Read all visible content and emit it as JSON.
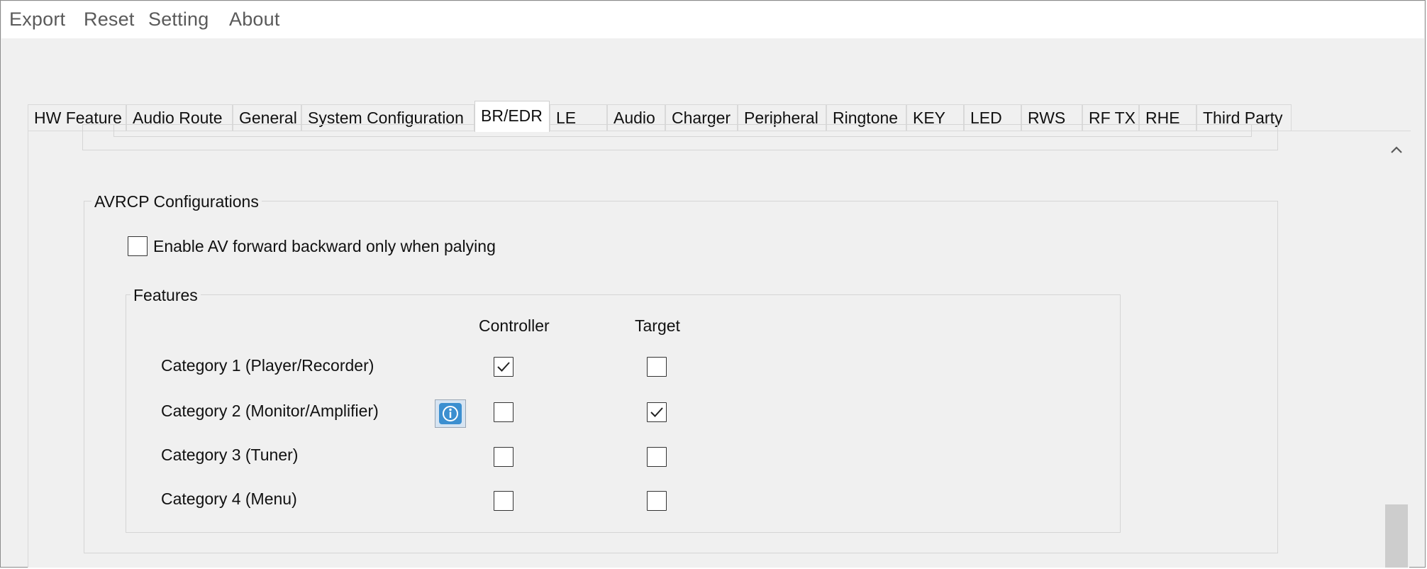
{
  "menu": {
    "items": [
      "Export",
      "Reset",
      "Setting",
      "About"
    ]
  },
  "tabs": [
    {
      "label": "HW Feature",
      "active": false
    },
    {
      "label": "Audio Route",
      "active": false
    },
    {
      "label": "General",
      "active": false
    },
    {
      "label": "System Configuration",
      "active": false
    },
    {
      "label": "BR/EDR",
      "active": true
    },
    {
      "label": "LE",
      "active": false
    },
    {
      "label": "Audio",
      "active": false
    },
    {
      "label": "Charger",
      "active": false
    },
    {
      "label": "Peripheral",
      "active": false
    },
    {
      "label": "Ringtone",
      "active": false
    },
    {
      "label": "KEY",
      "active": false
    },
    {
      "label": "LED",
      "active": false
    },
    {
      "label": "RWS",
      "active": false
    },
    {
      "label": "RF TX",
      "active": false
    },
    {
      "label": "RHE",
      "active": false
    },
    {
      "label": "Third Party",
      "active": false
    }
  ],
  "avrcp": {
    "title": "AVRCP Configurations",
    "enable_av_label": "Enable AV forward backward only when palying",
    "enable_av_checked": false,
    "features": {
      "title": "Features",
      "col_controller": "Controller",
      "col_target": "Target",
      "rows": [
        {
          "label": "Category 1 (Player/Recorder)",
          "controller": true,
          "target": false,
          "info": false
        },
        {
          "label": "Category 2 (Monitor/Amplifier)",
          "controller": false,
          "target": true,
          "info": true
        },
        {
          "label": "Category 3 (Tuner)",
          "controller": false,
          "target": false,
          "info": false
        },
        {
          "label": "Category 4 (Menu)",
          "controller": false,
          "target": false,
          "info": false
        }
      ]
    }
  },
  "icons": {
    "scroll_up": "chevron-up-icon",
    "info": "info-icon",
    "check": "checkmark-icon"
  },
  "colors": {
    "info_blue": "#3b8fd0",
    "panel_bg": "#f0f0f0"
  }
}
